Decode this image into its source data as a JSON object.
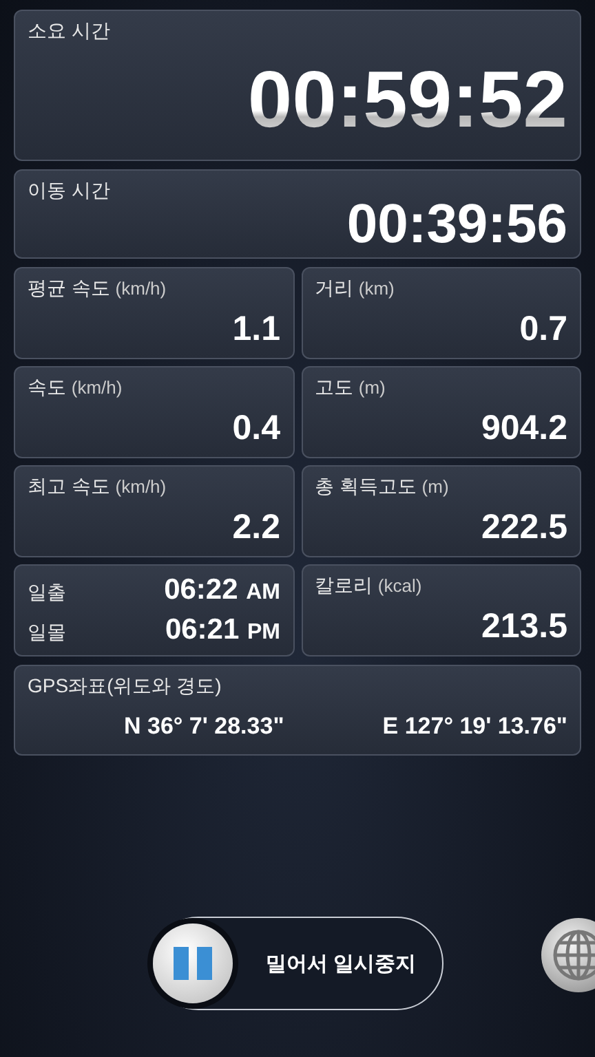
{
  "total_time": {
    "label": "소요 시간",
    "value": "00:59:52"
  },
  "moving_time": {
    "label": "이동 시간",
    "value": "00:39:56"
  },
  "cards": [
    {
      "kind": "stat",
      "label": "평균 속도",
      "unit": "(km/h)",
      "value": "1.1"
    },
    {
      "kind": "stat",
      "label": "거리",
      "unit": "(km)",
      "value": "0.7"
    },
    {
      "kind": "stat",
      "label": "속도",
      "unit": "(km/h)",
      "value": "0.4"
    },
    {
      "kind": "stat",
      "label": "고도",
      "unit": "(m)",
      "value": "904.2"
    },
    {
      "kind": "stat",
      "label": "최고 속도",
      "unit": "(km/h)",
      "value": "2.2"
    },
    {
      "kind": "stat",
      "label": "총 획득고도",
      "unit": "(m)",
      "value": "222.5"
    },
    {
      "kind": "sun",
      "rows": [
        {
          "label": "일출",
          "time": "06:22",
          "suffix": "AM"
        },
        {
          "label": "일몰",
          "time": "06:21",
          "suffix": "PM"
        }
      ]
    },
    {
      "kind": "stat",
      "label": "칼로리",
      "unit": "(kcal)",
      "value": "213.5"
    }
  ],
  "gps": {
    "label": "GPS좌표(위도와 경도)",
    "latitude": "N 36° 7' 28.33\"",
    "longitude": "E 127° 19' 13.76\""
  },
  "pause_slider": {
    "label": "밀어서 일시중지",
    "level": 0
  }
}
